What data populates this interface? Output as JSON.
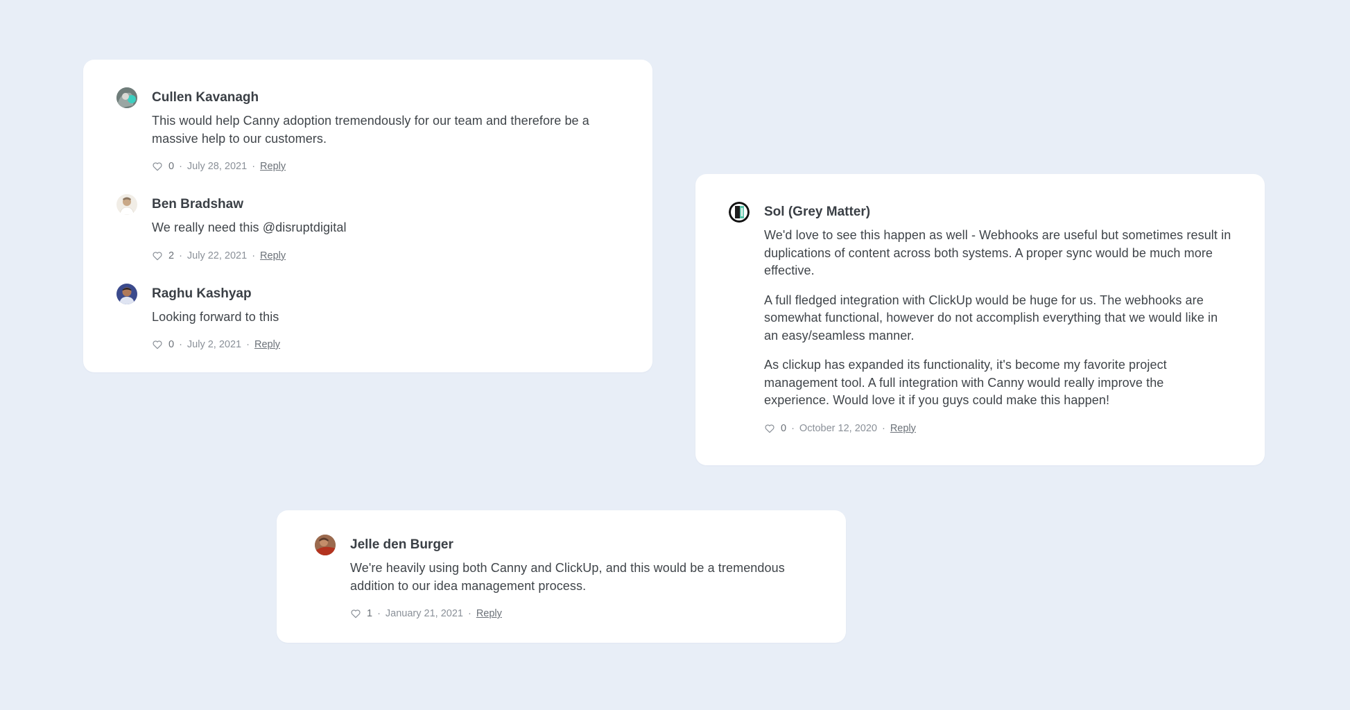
{
  "cards": [
    {
      "comments": [
        {
          "author": "Cullen Kavanagh",
          "avatar": "avatar-cullen",
          "paragraphs": [
            "This would help Canny adoption tremendously for our team and therefore be a massive help to our customers."
          ],
          "likes": "0",
          "date": "July 28, 2021",
          "reply": "Reply"
        },
        {
          "author": "Ben Bradshaw",
          "avatar": "avatar-ben",
          "paragraphs": [
            "We really need this @disruptdigital"
          ],
          "likes": "2",
          "date": "July 22, 2021",
          "reply": "Reply"
        },
        {
          "author": "Raghu Kashyap",
          "avatar": "avatar-raghu",
          "paragraphs": [
            "Looking forward to this"
          ],
          "likes": "0",
          "date": "July 2, 2021",
          "reply": "Reply"
        }
      ]
    },
    {
      "comments": [
        {
          "author": "Sol (Grey Matter)",
          "avatar": "avatar-sol",
          "paragraphs": [
            "We'd love to see this happen as well - Webhooks are useful but sometimes result in duplications of content across both systems. A proper sync would be much more effective.",
            "A full fledged integration with ClickUp would be huge for us. The webhooks are somewhat functional, however do not accomplish everything that we would like in an easy/seamless manner.",
            "As clickup has expanded its functionality, it's become my favorite project management tool. A full integration with Canny would really improve the experience. Would love it if you guys could make this happen!"
          ],
          "likes": "0",
          "date": "October 12, 2020",
          "reply": "Reply"
        }
      ]
    },
    {
      "comments": [
        {
          "author": "Jelle den Burger",
          "avatar": "avatar-jelle",
          "paragraphs": [
            "We're heavily using both Canny and ClickUp, and this would be a tremendous addition to our idea management process."
          ],
          "likes": "1",
          "date": "January 21, 2021",
          "reply": "Reply"
        }
      ]
    }
  ],
  "meta_separator": "·",
  "icons": {
    "like": "heart-icon"
  },
  "colors": {
    "background": "#e8eef7",
    "card": "#ffffff",
    "text": "#3f4449",
    "muted": "#8a9098"
  }
}
